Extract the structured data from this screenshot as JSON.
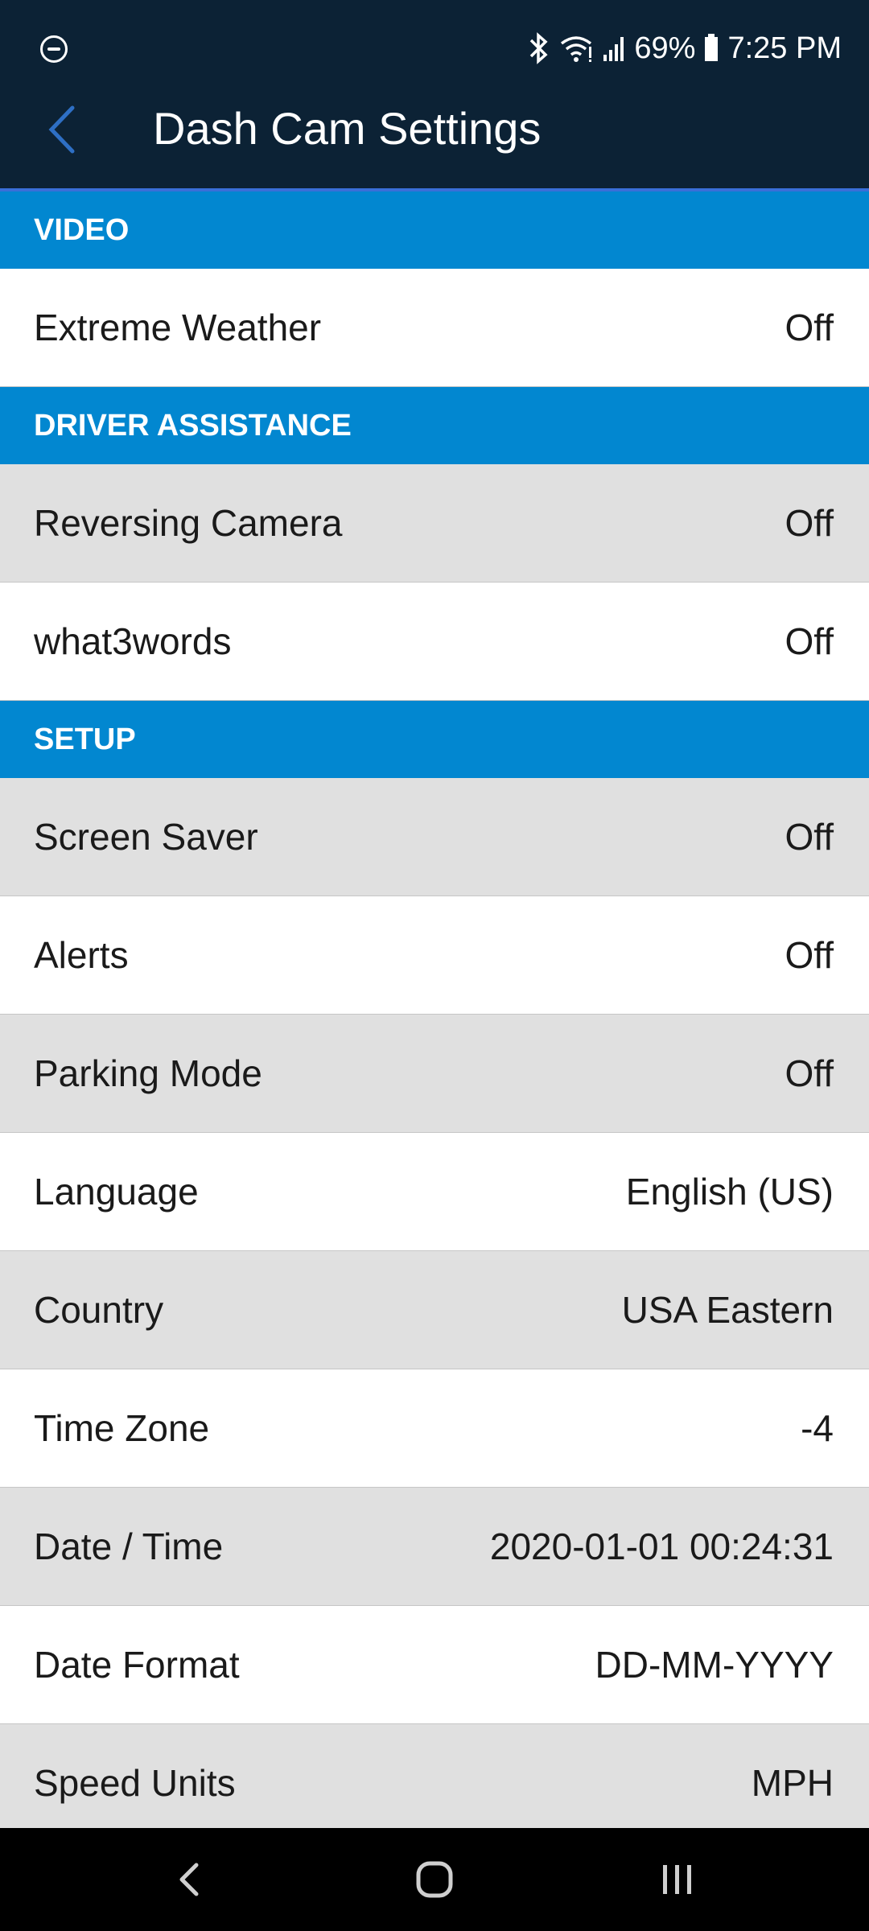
{
  "status_bar": {
    "dnd_icon": "do-not-disturb-icon",
    "battery_percent": "69%",
    "time": "7:25 PM"
  },
  "app_bar": {
    "title": "Dash Cam Settings",
    "back_icon": "chevron-left-icon"
  },
  "sections": [
    {
      "header": "VIDEO",
      "items": [
        {
          "label": "Extreme Weather",
          "value": "Off"
        }
      ]
    },
    {
      "header": "DRIVER ASSISTANCE",
      "items": [
        {
          "label": "Reversing Camera",
          "value": "Off"
        },
        {
          "label": "what3words",
          "value": "Off"
        }
      ]
    },
    {
      "header": "SETUP",
      "items": [
        {
          "label": "Screen Saver",
          "value": "Off"
        },
        {
          "label": "Alerts",
          "value": "Off"
        },
        {
          "label": "Parking Mode",
          "value": "Off"
        },
        {
          "label": "Language",
          "value": "English (US)"
        },
        {
          "label": "Country",
          "value": "USA Eastern"
        },
        {
          "label": "Time Zone",
          "value": "-4"
        },
        {
          "label": "Date / Time",
          "value": "2020-01-01 00:24:31"
        },
        {
          "label": "Date Format",
          "value": "DD-MM-YYYY"
        },
        {
          "label": "Speed Units",
          "value": "MPH"
        }
      ]
    }
  ],
  "colors": {
    "appbar": "#0c2235",
    "section_header": "#0287d0",
    "row_alt": "#e0e0e0",
    "row_plain": "#ffffff"
  }
}
